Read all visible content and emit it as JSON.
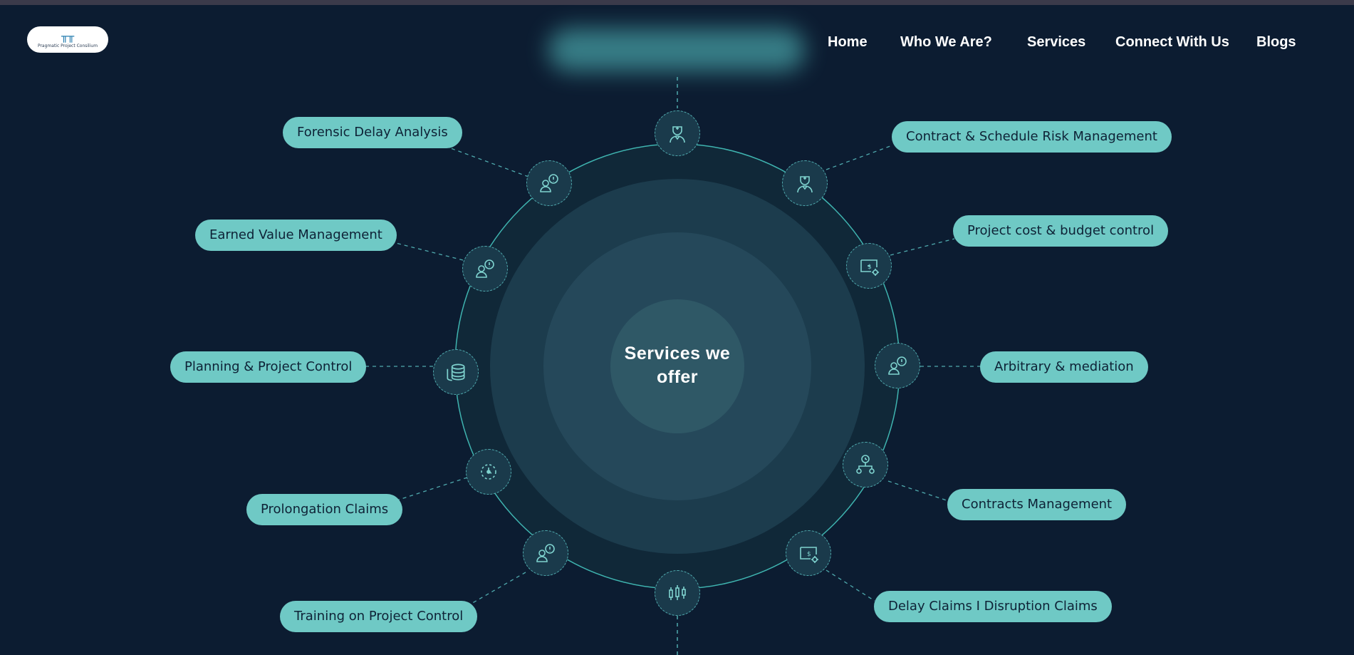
{
  "logo": {
    "text": "Pragmatic Project Consilium",
    "mark": "╥╥"
  },
  "nav": [
    {
      "label": "Home"
    },
    {
      "label": "Who We Are?"
    },
    {
      "label": "Services"
    },
    {
      "label": "Connect With Us"
    },
    {
      "label": "Blogs"
    }
  ],
  "hub": {
    "title": "Services we offer"
  },
  "services": [
    {
      "label": "Forensic Delay Analysis",
      "icon": "person-alert-icon"
    },
    {
      "label": "Earned Value Management",
      "icon": "person-alert-icon"
    },
    {
      "label": "Planning & Project Control",
      "icon": "coins-stack-icon"
    },
    {
      "label": "Prolongation Claims",
      "icon": "clock-progress-icon"
    },
    {
      "label": "Training on Project Control",
      "icon": "person-alert-icon"
    },
    {
      "label": "Contract & Schedule Risk Management",
      "icon": "engineer-icon"
    },
    {
      "label": "Project cost & budget control",
      "icon": "money-gear-icon"
    },
    {
      "label": "Arbitrary & mediation",
      "icon": "person-alert-icon"
    },
    {
      "label": "Contracts Management",
      "icon": "hierarchy-icon"
    },
    {
      "label": "Delay Claims I Disruption Claims",
      "icon": "money-gear-icon"
    }
  ],
  "extra_nodes": [
    {
      "icon": "engineer-icon"
    },
    {
      "icon": "candlestick-chart-icon"
    }
  ],
  "colors": {
    "background": "#0c1c31",
    "pill": "#6fc9c5",
    "pill_text": "#0e2236",
    "accent": "#4fa9ad"
  }
}
